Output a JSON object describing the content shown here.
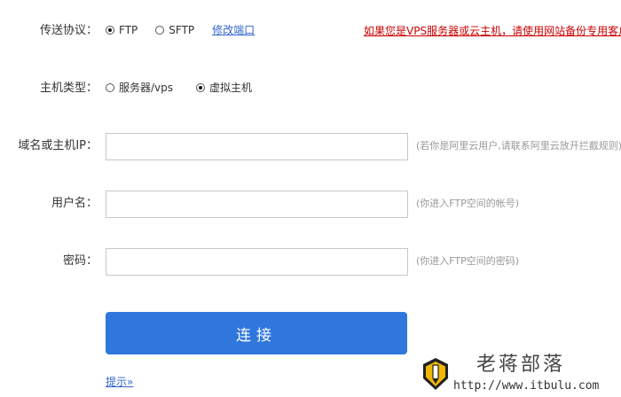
{
  "protocol": {
    "label": "传送协议：",
    "options": [
      "FTP",
      "SFTP"
    ],
    "selected": "FTP",
    "modify_port_link": "修改端口"
  },
  "vps_warning": "如果您是VPS服务器或云主机，请使用网站备份专用客户端",
  "host_type": {
    "label": "主机类型：",
    "options": [
      "服务器/vps",
      "虚拟主机"
    ],
    "selected": "虚拟主机"
  },
  "host_field": {
    "label": "域名或主机IP：",
    "value": "",
    "hint": "(若你是阿里云用户,请联系阿里云放开拦截规则)"
  },
  "username_field": {
    "label": "用户名：",
    "value": "",
    "hint": "(你进入FTP空间的帐号)"
  },
  "password_field": {
    "label": "密码：",
    "value": "",
    "hint": "(你进入FTP空间的密码)"
  },
  "connect_button": "连接",
  "tip_link": "提示»",
  "watermark": {
    "title": "老蒋部落",
    "url": "http://www.itbulu.com"
  },
  "colors": {
    "primary_button": "#2f77dc",
    "link": "#3366cc",
    "warning": "#cc0000",
    "hint": "#999999"
  }
}
